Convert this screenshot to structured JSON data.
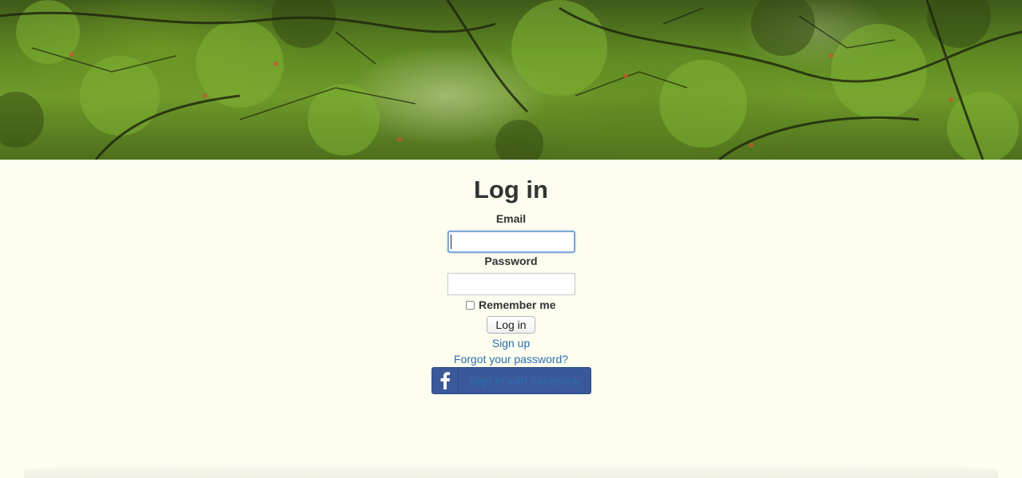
{
  "hero": {
    "image": "forest-canopy-banner"
  },
  "form": {
    "title": "Log in",
    "email_label": "Email",
    "email_value": "",
    "password_label": "Password",
    "password_value": "",
    "remember_label": "Remember me",
    "remember_checked": false,
    "submit_label": "Log in"
  },
  "links": {
    "signup": "Sign up",
    "forgot_password": "Forgot your password?"
  },
  "facebook": {
    "icon": "facebook-icon",
    "label": "Sign in with Facebook",
    "bg_color": "#3b5998"
  },
  "colors": {
    "page_bg": "#fdfdf0",
    "link": "#2a6fb0",
    "focus_border": "#7ea9d8"
  }
}
